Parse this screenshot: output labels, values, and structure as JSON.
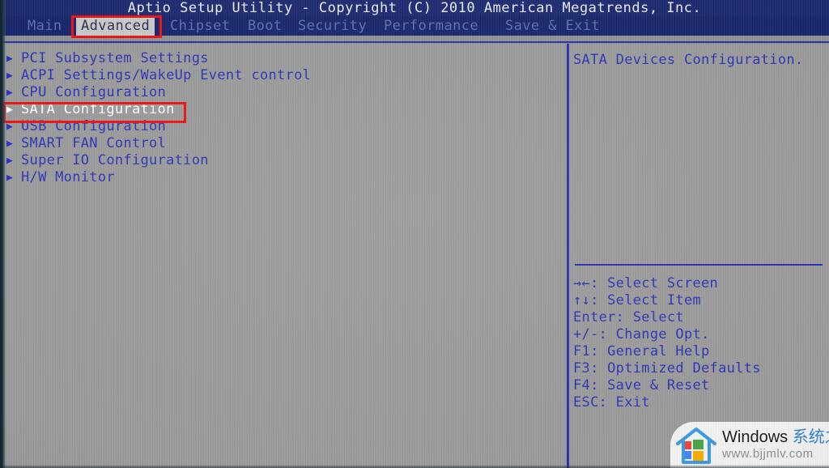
{
  "header": {
    "title": "Aptio Setup Utility - Copyright (C) 2010 American Megatrends, Inc."
  },
  "tabs": [
    {
      "label": "Main",
      "active": false
    },
    {
      "label": "Advanced",
      "active": true
    },
    {
      "label": "Chipset",
      "active": false
    },
    {
      "label": "Boot",
      "active": false
    },
    {
      "label": "Security",
      "active": false
    },
    {
      "label": "Performance",
      "active": false
    },
    {
      "label": "Save & Exit",
      "active": false
    }
  ],
  "menu": {
    "items": [
      {
        "caret": "▶",
        "label": "PCI Subsystem Settings",
        "selected": false
      },
      {
        "caret": "▶",
        "label": "ACPI Settings/WakeUp Event control",
        "selected": false
      },
      {
        "caret": "▶",
        "label": "CPU Configuration",
        "selected": false
      },
      {
        "caret": "▶",
        "label": "SATA Configuration",
        "selected": true
      },
      {
        "caret": "▶",
        "label": "USB Configuration",
        "selected": false
      },
      {
        "caret": "▶",
        "label": "SMART FAN Control",
        "selected": false
      },
      {
        "caret": "▶",
        "label": "Super IO Configuration",
        "selected": false
      },
      {
        "caret": "▶",
        "label": "H/W Monitor",
        "selected": false
      }
    ]
  },
  "help": {
    "text": "SATA Devices Configuration."
  },
  "keys": [
    "→←: Select Screen",
    "↑↓: Select Item",
    "Enter: Select",
    "+/-: Change Opt.",
    "F1: General Help",
    "F3: Optimized Defaults",
    "F4: Save & Reset",
    "ESC: Exit"
  ],
  "annotations": [
    {
      "target": "Advanced"
    },
    {
      "target": "SATA Configuration"
    }
  ],
  "watermark": {
    "brand_en": "Windows ",
    "brand_cn": "系统之家",
    "url": "www.bjjmlv.com"
  },
  "colors": {
    "header_blue": "#1d2a70",
    "tabbar_blue": "#18256a",
    "body_gray": "#9a9a9a",
    "text_blue": "#2b34b4",
    "selected_white": "#ffffff",
    "divider_blue": "#2b2fb2",
    "annotation_red": "#ee1111",
    "active_tab_bg": "#c9c9c9"
  }
}
